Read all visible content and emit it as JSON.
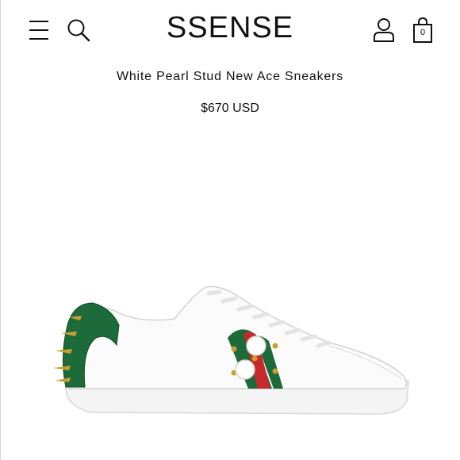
{
  "header": {
    "logo": "SSENSE",
    "menu_icon": "hamburger-menu-icon",
    "search_icon": "search-icon",
    "account_icon": "user-account-icon",
    "bag_icon": "shopping-bag-icon",
    "bag_count": "0"
  },
  "product": {
    "title": "White Pearl Stud New Ace Sneakers",
    "price": "$670 USD"
  },
  "colors": {
    "stripe_green": "#1d6b3a",
    "stripe_red": "#c62a2a",
    "stud_gold": "#c8a032",
    "text": "#111111"
  }
}
